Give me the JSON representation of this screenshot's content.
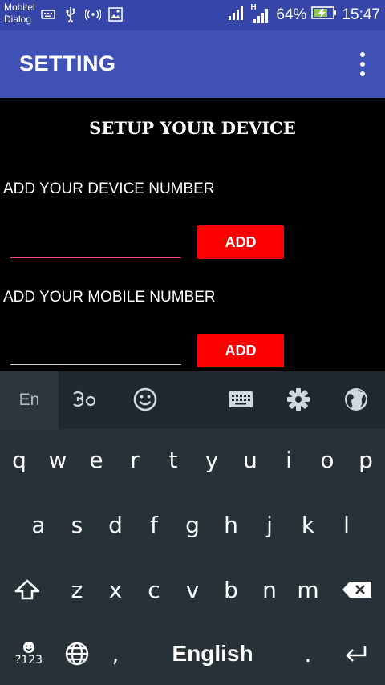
{
  "status_bar": {
    "carrier_1": "Mobitel",
    "carrier_2": "Dialog",
    "network_type": "H",
    "battery": "64%",
    "time": "15:47"
  },
  "app_bar": {
    "title": "SETTING"
  },
  "setup": {
    "title": "SETUP YOUR DEVICE",
    "device_label": "ADD YOUR DEVICE NUMBER",
    "device_value": "",
    "device_button": "ADD",
    "mobile_label": "ADD YOUR MOBILE NUMBER",
    "mobile_value": "",
    "mobile_button": "ADD"
  },
  "keyboard": {
    "language_tab": "En",
    "row1": [
      "q",
      "w",
      "e",
      "r",
      "t",
      "y",
      "u",
      "i",
      "o",
      "p"
    ],
    "row2": [
      "a",
      "s",
      "d",
      "f",
      "g",
      "h",
      "j",
      "k",
      "l"
    ],
    "row3": [
      "z",
      "x",
      "c",
      "v",
      "b",
      "n",
      "m"
    ],
    "symbols_label": "?123",
    "comma": ",",
    "space_label": "English",
    "period": "."
  },
  "colors": {
    "status_bar": "#3646a8",
    "app_bar": "#3f51b5",
    "button": "#ff0000",
    "focused_underline": "#ff4081",
    "keyboard_bg": "#263238"
  }
}
